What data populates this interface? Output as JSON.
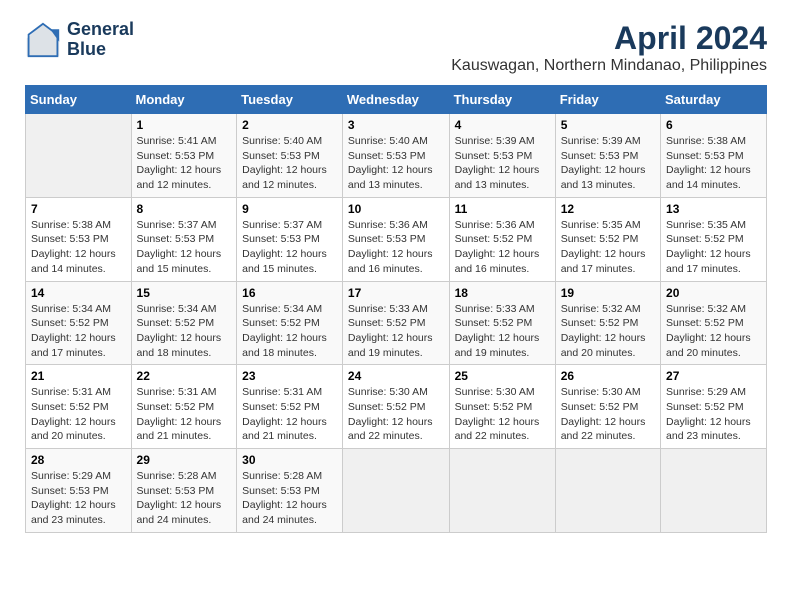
{
  "logo": {
    "line1": "General",
    "line2": "Blue"
  },
  "title": "April 2024",
  "subtitle": "Kauswagan, Northern Mindanao, Philippines",
  "days_header": [
    "Sunday",
    "Monday",
    "Tuesday",
    "Wednesday",
    "Thursday",
    "Friday",
    "Saturday"
  ],
  "weeks": [
    [
      {
        "num": "",
        "sunrise": "",
        "sunset": "",
        "daylight": ""
      },
      {
        "num": "1",
        "sunrise": "Sunrise: 5:41 AM",
        "sunset": "Sunset: 5:53 PM",
        "daylight": "Daylight: 12 hours and 12 minutes."
      },
      {
        "num": "2",
        "sunrise": "Sunrise: 5:40 AM",
        "sunset": "Sunset: 5:53 PM",
        "daylight": "Daylight: 12 hours and 12 minutes."
      },
      {
        "num": "3",
        "sunrise": "Sunrise: 5:40 AM",
        "sunset": "Sunset: 5:53 PM",
        "daylight": "Daylight: 12 hours and 13 minutes."
      },
      {
        "num": "4",
        "sunrise": "Sunrise: 5:39 AM",
        "sunset": "Sunset: 5:53 PM",
        "daylight": "Daylight: 12 hours and 13 minutes."
      },
      {
        "num": "5",
        "sunrise": "Sunrise: 5:39 AM",
        "sunset": "Sunset: 5:53 PM",
        "daylight": "Daylight: 12 hours and 13 minutes."
      },
      {
        "num": "6",
        "sunrise": "Sunrise: 5:38 AM",
        "sunset": "Sunset: 5:53 PM",
        "daylight": "Daylight: 12 hours and 14 minutes."
      }
    ],
    [
      {
        "num": "7",
        "sunrise": "Sunrise: 5:38 AM",
        "sunset": "Sunset: 5:53 PM",
        "daylight": "Daylight: 12 hours and 14 minutes."
      },
      {
        "num": "8",
        "sunrise": "Sunrise: 5:37 AM",
        "sunset": "Sunset: 5:53 PM",
        "daylight": "Daylight: 12 hours and 15 minutes."
      },
      {
        "num": "9",
        "sunrise": "Sunrise: 5:37 AM",
        "sunset": "Sunset: 5:53 PM",
        "daylight": "Daylight: 12 hours and 15 minutes."
      },
      {
        "num": "10",
        "sunrise": "Sunrise: 5:36 AM",
        "sunset": "Sunset: 5:53 PM",
        "daylight": "Daylight: 12 hours and 16 minutes."
      },
      {
        "num": "11",
        "sunrise": "Sunrise: 5:36 AM",
        "sunset": "Sunset: 5:52 PM",
        "daylight": "Daylight: 12 hours and 16 minutes."
      },
      {
        "num": "12",
        "sunrise": "Sunrise: 5:35 AM",
        "sunset": "Sunset: 5:52 PM",
        "daylight": "Daylight: 12 hours and 17 minutes."
      },
      {
        "num": "13",
        "sunrise": "Sunrise: 5:35 AM",
        "sunset": "Sunset: 5:52 PM",
        "daylight": "Daylight: 12 hours and 17 minutes."
      }
    ],
    [
      {
        "num": "14",
        "sunrise": "Sunrise: 5:34 AM",
        "sunset": "Sunset: 5:52 PM",
        "daylight": "Daylight: 12 hours and 17 minutes."
      },
      {
        "num": "15",
        "sunrise": "Sunrise: 5:34 AM",
        "sunset": "Sunset: 5:52 PM",
        "daylight": "Daylight: 12 hours and 18 minutes."
      },
      {
        "num": "16",
        "sunrise": "Sunrise: 5:34 AM",
        "sunset": "Sunset: 5:52 PM",
        "daylight": "Daylight: 12 hours and 18 minutes."
      },
      {
        "num": "17",
        "sunrise": "Sunrise: 5:33 AM",
        "sunset": "Sunset: 5:52 PM",
        "daylight": "Daylight: 12 hours and 19 minutes."
      },
      {
        "num": "18",
        "sunrise": "Sunrise: 5:33 AM",
        "sunset": "Sunset: 5:52 PM",
        "daylight": "Daylight: 12 hours and 19 minutes."
      },
      {
        "num": "19",
        "sunrise": "Sunrise: 5:32 AM",
        "sunset": "Sunset: 5:52 PM",
        "daylight": "Daylight: 12 hours and 20 minutes."
      },
      {
        "num": "20",
        "sunrise": "Sunrise: 5:32 AM",
        "sunset": "Sunset: 5:52 PM",
        "daylight": "Daylight: 12 hours and 20 minutes."
      }
    ],
    [
      {
        "num": "21",
        "sunrise": "Sunrise: 5:31 AM",
        "sunset": "Sunset: 5:52 PM",
        "daylight": "Daylight: 12 hours and 20 minutes."
      },
      {
        "num": "22",
        "sunrise": "Sunrise: 5:31 AM",
        "sunset": "Sunset: 5:52 PM",
        "daylight": "Daylight: 12 hours and 21 minutes."
      },
      {
        "num": "23",
        "sunrise": "Sunrise: 5:31 AM",
        "sunset": "Sunset: 5:52 PM",
        "daylight": "Daylight: 12 hours and 21 minutes."
      },
      {
        "num": "24",
        "sunrise": "Sunrise: 5:30 AM",
        "sunset": "Sunset: 5:52 PM",
        "daylight": "Daylight: 12 hours and 22 minutes."
      },
      {
        "num": "25",
        "sunrise": "Sunrise: 5:30 AM",
        "sunset": "Sunset: 5:52 PM",
        "daylight": "Daylight: 12 hours and 22 minutes."
      },
      {
        "num": "26",
        "sunrise": "Sunrise: 5:30 AM",
        "sunset": "Sunset: 5:52 PM",
        "daylight": "Daylight: 12 hours and 22 minutes."
      },
      {
        "num": "27",
        "sunrise": "Sunrise: 5:29 AM",
        "sunset": "Sunset: 5:52 PM",
        "daylight": "Daylight: 12 hours and 23 minutes."
      }
    ],
    [
      {
        "num": "28",
        "sunrise": "Sunrise: 5:29 AM",
        "sunset": "Sunset: 5:53 PM",
        "daylight": "Daylight: 12 hours and 23 minutes."
      },
      {
        "num": "29",
        "sunrise": "Sunrise: 5:28 AM",
        "sunset": "Sunset: 5:53 PM",
        "daylight": "Daylight: 12 hours and 24 minutes."
      },
      {
        "num": "30",
        "sunrise": "Sunrise: 5:28 AM",
        "sunset": "Sunset: 5:53 PM",
        "daylight": "Daylight: 12 hours and 24 minutes."
      },
      {
        "num": "",
        "sunrise": "",
        "sunset": "",
        "daylight": ""
      },
      {
        "num": "",
        "sunrise": "",
        "sunset": "",
        "daylight": ""
      },
      {
        "num": "",
        "sunrise": "",
        "sunset": "",
        "daylight": ""
      },
      {
        "num": "",
        "sunrise": "",
        "sunset": "",
        "daylight": ""
      }
    ]
  ]
}
